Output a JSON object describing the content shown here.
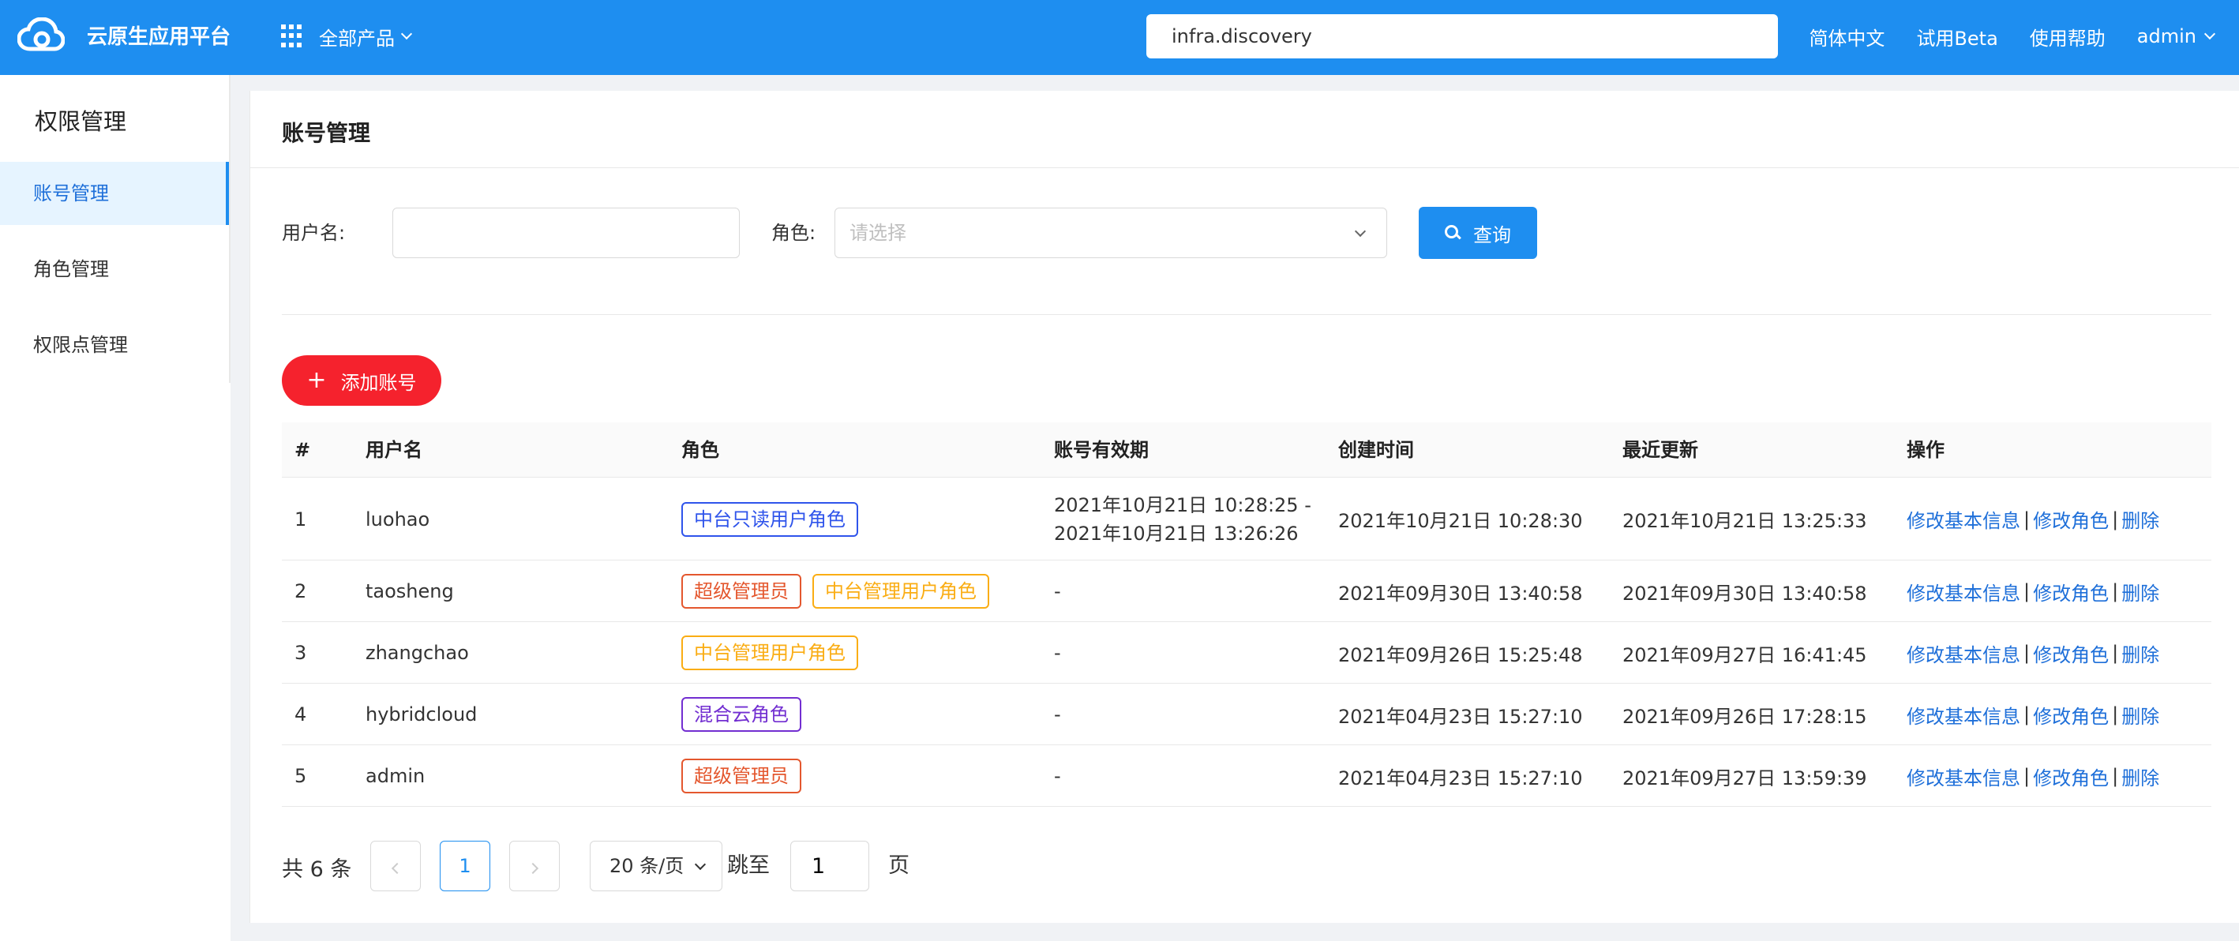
{
  "header": {
    "brand": "云原生应用平台",
    "all_products": "全部产品",
    "search_value": "infra.discovery",
    "links": [
      "简体中文",
      "试用Beta",
      "使用帮助"
    ],
    "user": "admin",
    "bg_color": "#1e8ef0"
  },
  "sidebar": {
    "title": "权限管理",
    "items": [
      {
        "label": "账号管理",
        "active": true
      },
      {
        "label": "角色管理",
        "active": false
      },
      {
        "label": "权限点管理",
        "active": false
      }
    ]
  },
  "main": {
    "title": "账号管理",
    "filters": {
      "username_label": "用户名:",
      "role_label": "角色:",
      "role_placeholder": "请选择",
      "query_button": "查询"
    },
    "add_button": "添加账号",
    "table": {
      "columns": [
        "#",
        "用户名",
        "角色",
        "账号有效期",
        "创建时间",
        "最近更新",
        "操作"
      ],
      "rows": [
        {
          "idx": "1",
          "username": "luohao",
          "roles": [
            {
              "text": "中台只读用户角色",
              "color": "#2f54eb"
            }
          ],
          "validity": [
            "2021年10月21日 10:28:25 -",
            "2021年10月21日 13:26:26"
          ],
          "created": "2021年10月21日 10:28:30",
          "updated": "2021年10月21日 13:25:33"
        },
        {
          "idx": "2",
          "username": "taosheng",
          "roles": [
            {
              "text": "超级管理员",
              "color": "#e4572e"
            },
            {
              "text": "中台管理用户角色",
              "color": "#faad14"
            }
          ],
          "validity": [
            "-"
          ],
          "created": "2021年09月30日 13:40:58",
          "updated": "2021年09月30日 13:40:58"
        },
        {
          "idx": "3",
          "username": "zhangchao",
          "roles": [
            {
              "text": "中台管理用户角色",
              "color": "#faad14"
            }
          ],
          "validity": [
            "-"
          ],
          "created": "2021年09月26日 15:25:48",
          "updated": "2021年09月27日 16:41:45"
        },
        {
          "idx": "4",
          "username": "hybridcloud",
          "roles": [
            {
              "text": "混合云角色",
              "color": "#722ed1"
            }
          ],
          "validity": [
            "-"
          ],
          "created": "2021年04月23日 15:27:10",
          "updated": "2021年09月26日 17:28:15"
        },
        {
          "idx": "5",
          "username": "admin",
          "roles": [
            {
              "text": "超级管理员",
              "color": "#e4572e"
            }
          ],
          "validity": [
            "-"
          ],
          "created": "2021年04月23日 15:27:10",
          "updated": "2021年09月27日 13:59:39"
        }
      ],
      "actions": [
        "修改基本信息",
        "修改角色",
        "删除"
      ]
    },
    "pagination": {
      "total": "共 6 条",
      "current_page": "1",
      "page_size": "20 条/页",
      "jump_label": "跳至",
      "jump_value": "1",
      "page_suffix": "页"
    }
  }
}
